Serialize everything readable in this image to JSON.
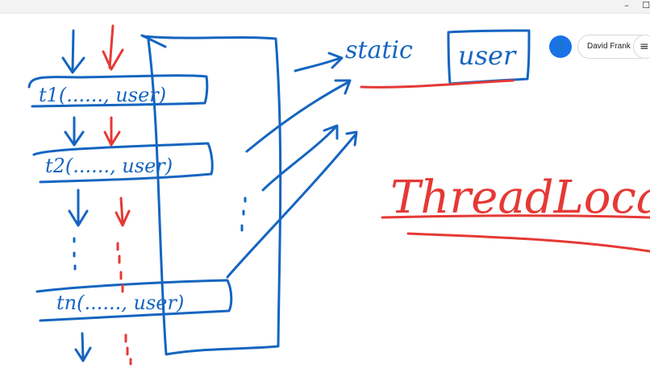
{
  "window": {
    "minimize_glyph": "–",
    "maximize_glyph": "☐"
  },
  "user": {
    "name": "David Frank",
    "avatar_icon": "person-icon",
    "avatar_glyph": "👤",
    "menu_glyph": "≡"
  },
  "whiteboard": {
    "pen_blue": "#1565c0",
    "pen_red": "#e53935",
    "threads": [
      {
        "call": "t1(......, user)"
      },
      {
        "call": "t2(......, user)"
      },
      {
        "call": "tn(......, user)"
      }
    ],
    "static_label": "static",
    "static_var": "user",
    "title_word": "ThreadLocal",
    "ellipsis_dots": ":"
  }
}
